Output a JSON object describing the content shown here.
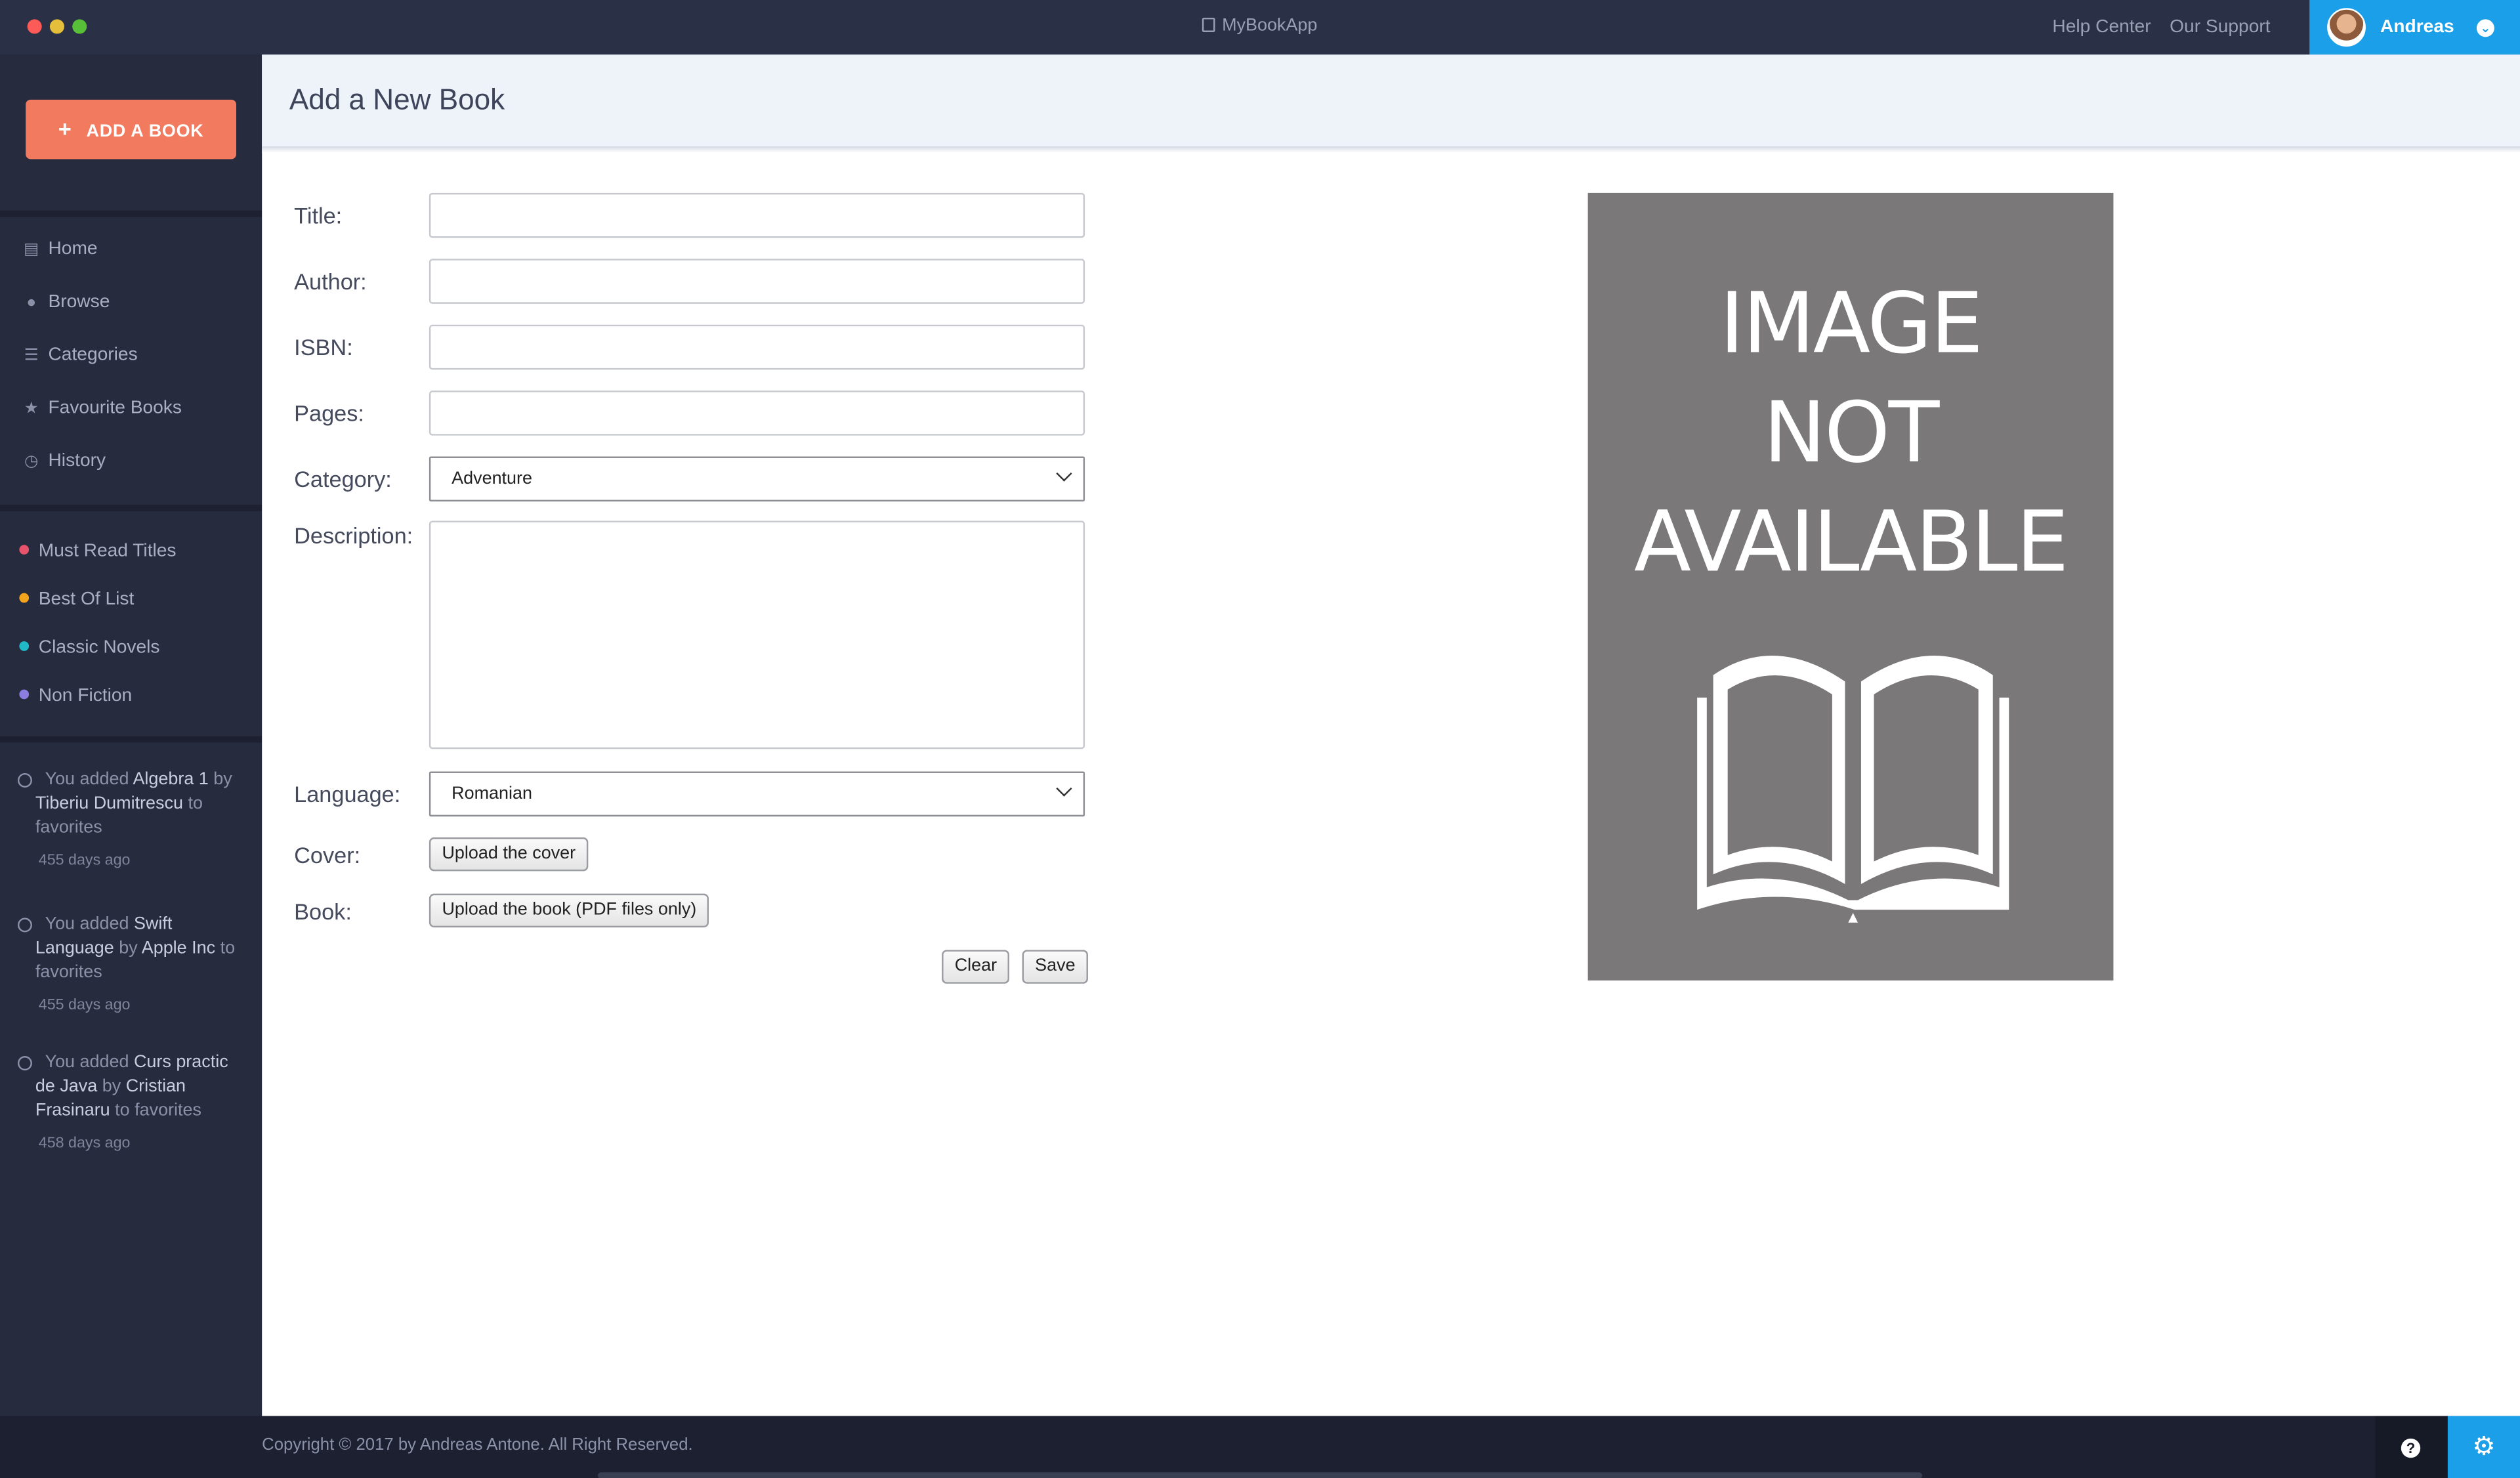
{
  "window": {
    "title": "MyBookApp"
  },
  "topbar": {
    "help_center": "Help Center",
    "our_support": "Our Support",
    "user_name": "Andreas"
  },
  "sidebar": {
    "add_book_label": "ADD A BOOK",
    "nav": [
      {
        "label": "Home",
        "icon": "book-icon"
      },
      {
        "label": "Browse",
        "icon": "globe-icon"
      },
      {
        "label": "Categories",
        "icon": "list-icon"
      },
      {
        "label": "Favourite Books",
        "icon": "star-icon"
      },
      {
        "label": "History",
        "icon": "clock-icon"
      }
    ],
    "lists": [
      {
        "label": "Must Read Titles",
        "color": "#e8536b"
      },
      {
        "label": "Best Of List",
        "color": "#f3a41d"
      },
      {
        "label": "Classic Novels",
        "color": "#21b9c6"
      },
      {
        "label": "Non Fiction",
        "color": "#8b7ee0"
      }
    ],
    "activity": [
      {
        "prefix": "You added",
        "title": "Algebra 1",
        "by": "by",
        "author": "Tiberiu Dumitrescu",
        "suffix": "to favorites",
        "ago": "455 days ago"
      },
      {
        "prefix": "You added",
        "title": "Swift Language",
        "by": "by",
        "author": "Apple Inc",
        "suffix": "to favorites",
        "ago": "455 days ago"
      },
      {
        "prefix": "You added",
        "title": "Curs practic de Java",
        "by": "by",
        "author": "Cristian Frasinaru",
        "suffix": "to favorites",
        "ago": "458 days ago"
      }
    ]
  },
  "main": {
    "page_title": "Add a New Book",
    "form": {
      "title_label": "Title:",
      "author_label": "Author:",
      "isbn_label": "ISBN:",
      "pages_label": "Pages:",
      "category_label": "Category:",
      "category_value": "Adventure",
      "description_label": "Description:",
      "language_label": "Language:",
      "language_value": "Romanian",
      "cover_label": "Cover:",
      "cover_button": "Upload the cover",
      "book_label": "Book:",
      "book_button": "Upload the book (PDF files only)",
      "clear_button": "Clear",
      "save_button": "Save"
    },
    "cover_placeholder": {
      "line1": "IMAGE",
      "line2": "NOT",
      "line3": "AVAILABLE",
      "bg_color": "#7b7879"
    }
  },
  "footer": {
    "copyright": "Copyright © 2017 by Andreas Antone. All Right Reserved.",
    "help_icon": "question-icon",
    "settings_icon": "gear-icon"
  },
  "colors": {
    "accent": "#1a9fe8",
    "add_button": "#f27b5f",
    "sidebar_bg": "#262b3e"
  }
}
